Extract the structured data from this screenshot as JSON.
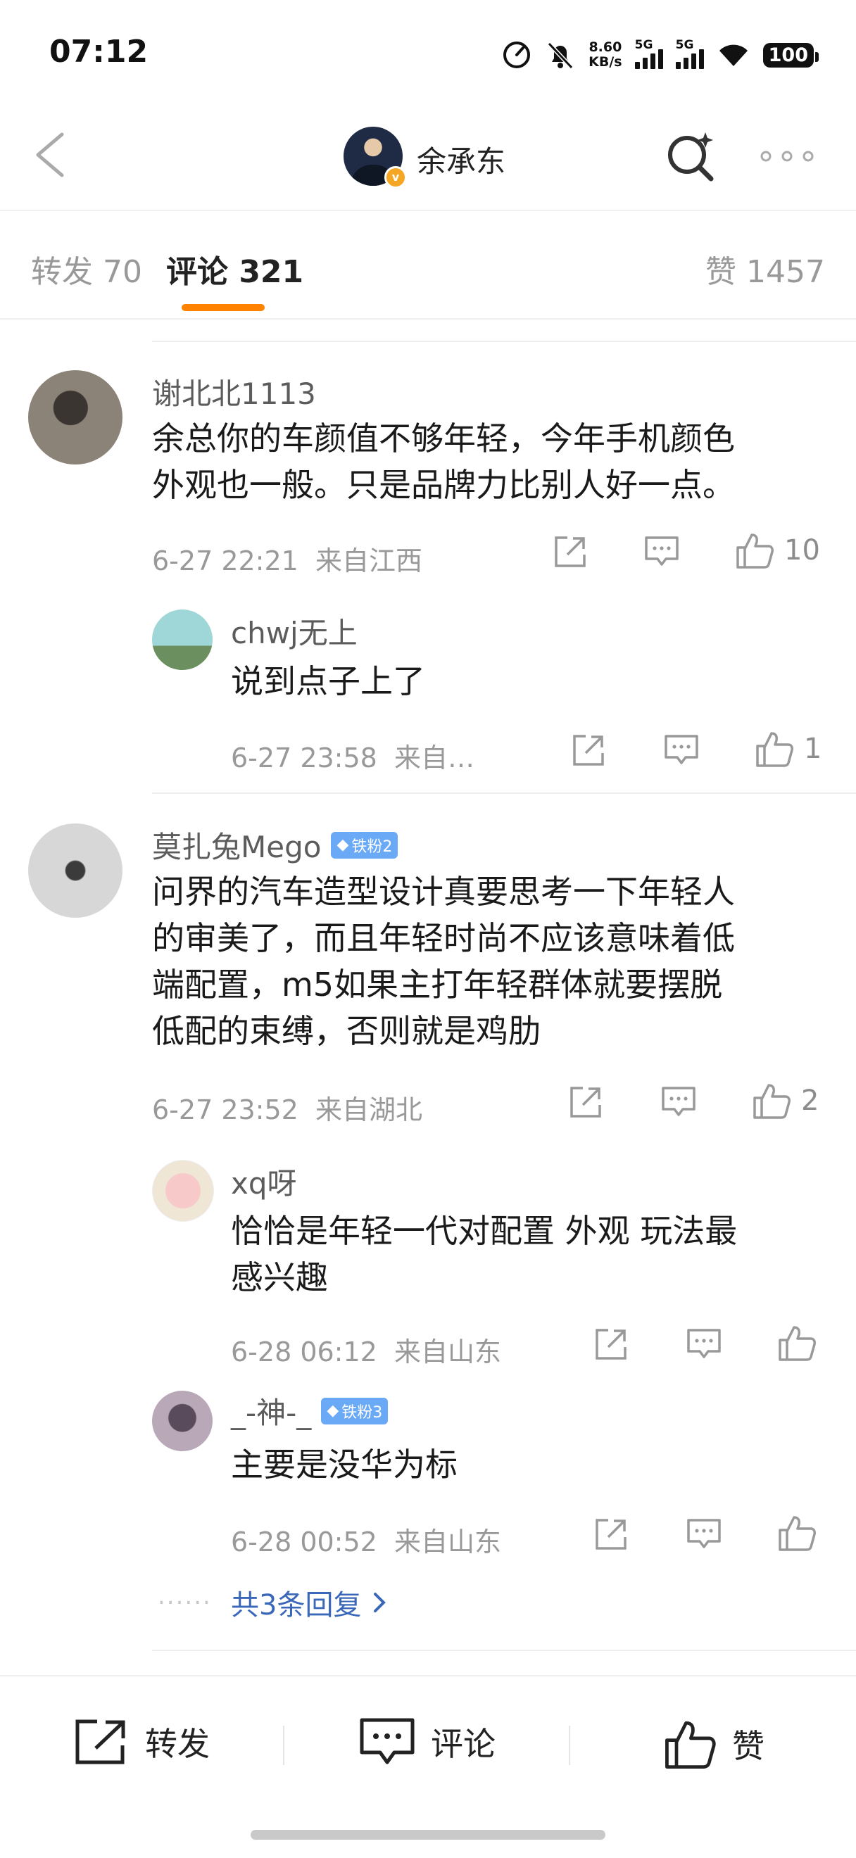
{
  "status_bar": {
    "time": "07:12",
    "net_speed_value": "8.60",
    "net_speed_unit": "KB/s",
    "sim1": "5G",
    "sim2": "5G",
    "battery": "100"
  },
  "nav": {
    "title": "余承东",
    "back_icon": "chevron-left-icon",
    "search_icon": "search-icon",
    "more_icon": "more-dots-icon"
  },
  "tabs": {
    "repost": "转发 70",
    "comments": "评论 321",
    "likes": "赞 1457"
  },
  "comments": [
    {
      "user": "谢北北1113",
      "text_lines": [
        "余总你的车颜值不够年轻，今年手机颜色",
        "外观也一般。只是品牌力比别人好一点。"
      ],
      "time": "6-27 22:21",
      "location": "来自江西",
      "likes": "10",
      "replies": [
        {
          "user": "chwj无上",
          "text_lines": [
            "说到点子上了"
          ],
          "time": "6-27 23:58",
          "location": "来自…",
          "likes": "1"
        }
      ]
    },
    {
      "user": "莫扎兔Mego",
      "badge": "铁粉2",
      "text_lines": [
        "问界的汽车造型设计真要思考一下年轻人",
        "的审美了，而且年轻时尚不应该意味着低",
        "端配置，m5如果主打年轻群体就要摆脱",
        "低配的束缚，否则就是鸡肋"
      ],
      "time": "6-27 23:52",
      "location": "来自湖北",
      "likes": "2",
      "replies": [
        {
          "user": "xq呀",
          "text_lines": [
            "恰恰是年轻一代对配置 外观 玩法最",
            "感兴趣"
          ],
          "time": "6-28 06:12",
          "location": "来自山东",
          "likes": ""
        },
        {
          "user": "_-神-_",
          "badge": "铁粉3",
          "text_lines": [
            "主要是没华为标"
          ],
          "time": "6-28 00:52",
          "location": "来自山东",
          "likes": ""
        }
      ],
      "more_replies": "共3条回复",
      "more_dots": "......"
    }
  ],
  "bottom_bar": {
    "repost": "转发",
    "comment": "评论",
    "like": "赞"
  },
  "colors": {
    "accent": "#ff8200",
    "link": "#3a67b8",
    "badge": "#6aa9f5"
  }
}
